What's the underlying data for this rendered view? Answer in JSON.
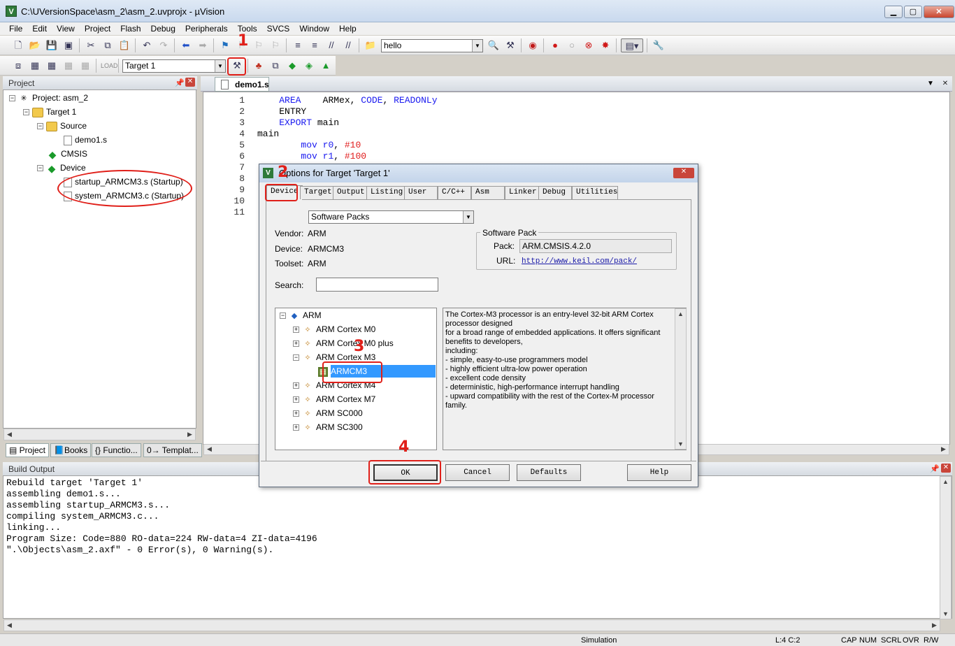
{
  "window": {
    "title": "C:\\UVersionSpace\\asm_2\\asm_2.uvprojx - µVision",
    "min": "▁",
    "max": "▢",
    "close": "✕"
  },
  "menu": [
    "File",
    "Edit",
    "View",
    "Project",
    "Flash",
    "Debug",
    "Peripherals",
    "Tools",
    "SVCS",
    "Window",
    "Help"
  ],
  "toolbar": {
    "find_combo": "hello",
    "target_combo": "Target 1"
  },
  "annotations": {
    "n1": "1",
    "n2": "2",
    "n3": "3",
    "n4": "4"
  },
  "project_panel": {
    "title": "Project",
    "root": "Project: asm_2",
    "target": "Target 1",
    "source": "Source",
    "file1": "demo1.s",
    "cmsis": "CMSIS",
    "device": "Device",
    "startup": "startup_ARMCM3.s (Startup)",
    "system": "system_ARMCM3.c (Startup)",
    "tabs": [
      "Project",
      "Books",
      "{} Functio...",
      "0→ Templat..."
    ]
  },
  "editor": {
    "tab": "demo1.s",
    "line_numbers": [
      "1",
      "2",
      "3",
      "4",
      "5",
      "6",
      "7",
      "8",
      "9",
      "10",
      "11"
    ],
    "lines": [
      {
        "ind": "    ",
        "kw": "AREA",
        "rest": "    ARMex, ",
        "kw2": "CODE",
        "rest2": ", ",
        "kw3": "READONLy"
      },
      {
        "ind": "    ",
        "plain": "ENTRY"
      },
      {
        "ind": "    ",
        "kw": "EXPORT",
        "rest": " main"
      },
      {
        "ind": "",
        "plain": "main"
      },
      {
        "ind": "        ",
        "kw": "mov",
        "reg": "r0",
        "num": "#10"
      },
      {
        "ind": "        ",
        "kw": "mov",
        "reg": "r1",
        "num": "#100"
      }
    ]
  },
  "dialog": {
    "title": "Options for Target 'Target 1'",
    "tabs": [
      "Device",
      "Target",
      "Output",
      "Listing",
      "User",
      "C/C++",
      "Asm",
      "Linker",
      "Debug",
      "Utilities"
    ],
    "db_combo": "Software Packs",
    "vendor_label": "Vendor:",
    "vendor": "ARM",
    "device_label": "Device:",
    "device": "ARMCM3",
    "toolset_label": "Toolset:",
    "toolset": "ARM",
    "search_label": "Search:",
    "search_value": "",
    "pack_group": "Software Pack",
    "pack_label": "Pack:",
    "pack": "ARM.CMSIS.4.2.0",
    "url_label": "URL:",
    "url": "http://www.keil.com/pack/",
    "tree": [
      "ARM",
      "ARM Cortex M0",
      "ARM Cortex M0 plus",
      "ARM Cortex M3",
      "ARMCM3",
      "ARM Cortex M4",
      "ARM Cortex M7",
      "ARM SC000",
      "ARM SC300"
    ],
    "description": [
      "The Cortex-M3 processor is an entry-level 32-bit ARM Cortex processor designed",
      "for a broad range of embedded applications. It offers significant benefits to developers,",
      "including:",
      "- simple, easy-to-use programmers model",
      "- highly efficient ultra-low power operation",
      "- excellent code density",
      "- deterministic, high-performance interrupt handling",
      "- upward compatibility with the rest of the Cortex-M processor family."
    ],
    "buttons": {
      "ok": "OK",
      "cancel": "Cancel",
      "defaults": "Defaults",
      "help": "Help"
    }
  },
  "build_output": {
    "title": "Build Output",
    "lines": [
      "Rebuild target 'Target 1'",
      "assembling demo1.s...",
      "assembling startup_ARMCM3.s...",
      "compiling system_ARMCM3.c...",
      "linking...",
      "Program Size: Code=880 RO-data=224 RW-data=4 ZI-data=4196",
      "\".\\Objects\\asm_2.axf\" - 0 Error(s), 0 Warning(s)."
    ]
  },
  "status": {
    "mode": "Simulation",
    "pos": "L:4 C:2",
    "cap": "CAP",
    "num": "NUM",
    "scrl": "SCRL",
    "ovr": "OVR",
    "rw": "R/W"
  }
}
